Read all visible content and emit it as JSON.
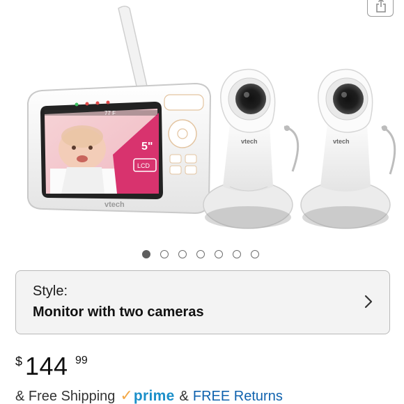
{
  "header": {
    "share_icon": "share-icon"
  },
  "gallery": {
    "image": {
      "lcd_size": "5\"",
      "lcd_label": "LCD",
      "monitor_brand": "vtech",
      "camera_brand": "vtech",
      "screen_status": "77 F"
    },
    "dot_count": 7,
    "active_index": 0
  },
  "style": {
    "label": "Style:",
    "value": "Monitor with two cameras",
    "chevron_icon": "chevron-right-icon"
  },
  "price": {
    "currency": "$",
    "whole": "144",
    "fraction": "99"
  },
  "shipping": {
    "prefix": "& Free Shipping",
    "prime_check": "✓",
    "prime_word": "prime",
    "amp": "&",
    "returns": "FREE Returns"
  },
  "colors": {
    "prime_blue": "#1b8fc9",
    "prime_orange": "#f3a847",
    "link_blue": "#0f62ae",
    "lcd_pink": "#d8336e"
  }
}
